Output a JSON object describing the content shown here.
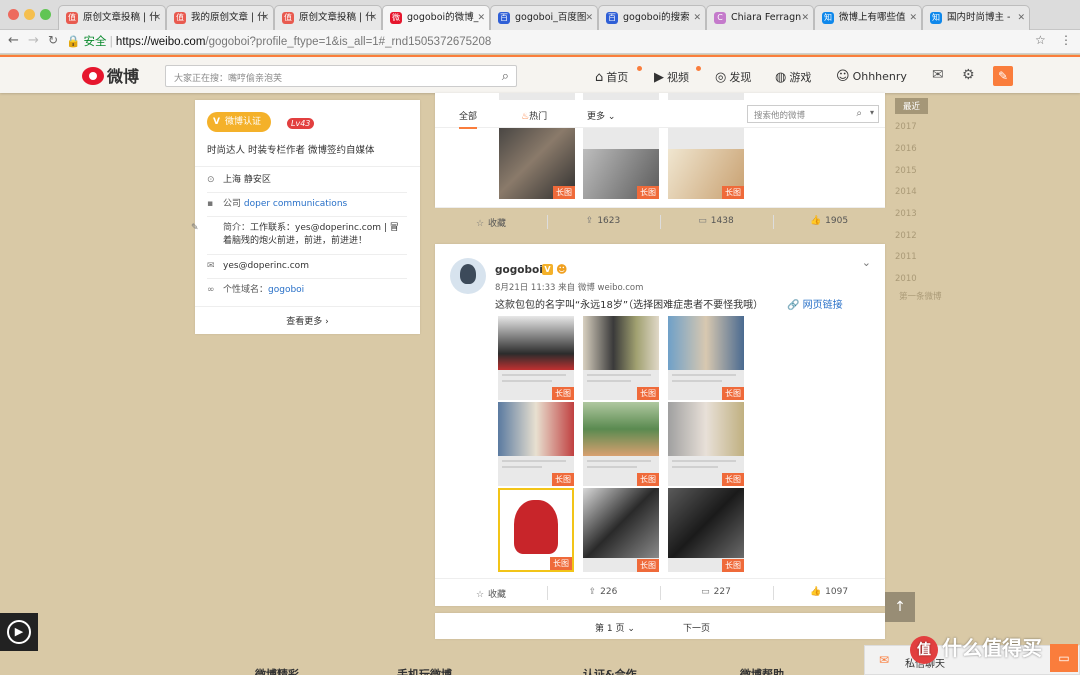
{
  "browser": {
    "tabs": [
      {
        "label": "原创文章投稿 | 什",
        "icon": "zhide-icon",
        "color": "#e85a4f"
      },
      {
        "label": "我的原创文章 | 什",
        "icon": "zhide-icon",
        "color": "#e85a4f"
      },
      {
        "label": "原创文章投稿 | 什",
        "icon": "zhide-icon",
        "color": "#e85a4f"
      },
      {
        "label": "gogoboi的微博_",
        "icon": "weibo-icon",
        "color": "#e6162d"
      },
      {
        "label": "gogoboi_百度图",
        "icon": "baidu-icon",
        "color": "#2f5fd6"
      },
      {
        "label": "gogoboi的搜索",
        "icon": "baidu-icon",
        "color": "#2f5fd6"
      },
      {
        "label": "Chiara Ferragn",
        "icon": "web-icon",
        "color": "#c47acb"
      },
      {
        "label": "微博上有哪些值",
        "icon": "zhihu-icon",
        "color": "#0f88eb"
      },
      {
        "label": "国内时尚博主 -",
        "icon": "zhihu-icon",
        "color": "#0f88eb"
      }
    ],
    "address": {
      "secure_label": "安全",
      "domain": "https://weibo.com",
      "path": "/gogoboi?profile_ftype=1&is_all=1#_rnd1505372675208"
    }
  },
  "header": {
    "logo_text": "微博",
    "search_placeholder": "大家正在搜：嘴哼偷亲泡芙",
    "nav": {
      "home": "首页",
      "video": "视频",
      "discover": "发现",
      "game": "游戏",
      "user": "Ohhhenry"
    }
  },
  "profile": {
    "verified_label": "微博认证",
    "level": "Lv43",
    "verify_desc": "时尚达人 时装专栏作者 微博签约自媒体",
    "location": "上海 静安区",
    "company_label": "公司",
    "company": "doper communications",
    "intro_label": "简介：",
    "intro": "工作联系：yes@doperinc.com | 冒着脑残的炮火前进，前进，前进进！",
    "email": "yes@doperinc.com",
    "domain_label": "个性域名：",
    "domain": "gogoboi",
    "more": "查看更多"
  },
  "feed": {
    "tabs": {
      "all": "全部",
      "hot": "热门",
      "more": "更多"
    },
    "search_placeholder": "搜索他的微博",
    "long_tag": "长图",
    "card1": {
      "collect": "收藏",
      "reposts": "1623",
      "comments": "1438",
      "likes": "1905"
    },
    "card2": {
      "user": "gogoboi",
      "meta": "8月21日 11:33 来自 微博 weibo.com",
      "text": "这款包包的名字叫“永远18岁”（选择困难症患者不要怪我哦）",
      "web_link": "网页链接",
      "collect": "收藏",
      "reposts": "226",
      "comments": "227",
      "likes": "1097"
    },
    "pager": {
      "current": "第 1 页",
      "next": "下一页"
    }
  },
  "timeline": {
    "items": [
      "最近",
      "2017",
      "2016",
      "2015",
      "2014",
      "2013",
      "2012",
      "2011",
      "2010",
      "第一条微博"
    ]
  },
  "footer": {
    "cols": [
      "微博精彩",
      "手机玩微博",
      "认证&合作",
      "微博帮助"
    ]
  },
  "chat": {
    "label": "私信聊天"
  },
  "watermark": {
    "text": "什么值得买",
    "logo_char": "值"
  },
  "colors": {
    "accent": "#fa7d3c",
    "link": "#2870c8",
    "verified": "#f4b12a"
  }
}
